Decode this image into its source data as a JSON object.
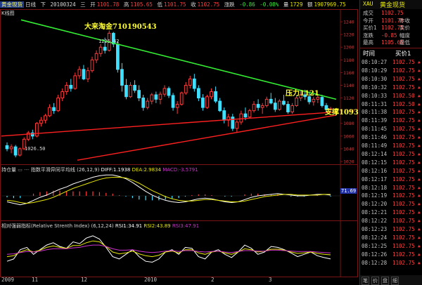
{
  "quote_bar": {
    "name": "黄金现货",
    "period": "日线",
    "direction": "下",
    "date": "20100324",
    "weekday": "三",
    "open_label": "开",
    "open": "1101.78",
    "high_label": "高",
    "high": "1105.65",
    "low_label": "低",
    "low": "1101.75",
    "close_label": "收",
    "close": "1102.75",
    "change_label": "涨跌",
    "change": "-0.86",
    "change_pct": "-0.08%",
    "volume_label": "量",
    "volume": "1729",
    "amount_label": "额",
    "amount": "1907969.75"
  },
  "main_panel": {
    "tag": "K线图",
    "price_axis": [
      "1240",
      "1220",
      "1200",
      "1180",
      "1160",
      "1140",
      "1120",
      "1100",
      "1080",
      "1060",
      "1040",
      "1020"
    ],
    "high_mark": "1226.42",
    "low_mark": "1026.50",
    "annotation_title": "大来淘金710190543",
    "annotation_resistance": "压力1121",
    "annotation_support": "支撑1093"
  },
  "macd_panel": {
    "title": "持仓量",
    "desc": "指数平滑异同平均线",
    "params": "(26,12,9)",
    "diff_label": "DIFF:",
    "diff": "1.1938",
    "dea_label": "DEA:",
    "dea": "2.9834",
    "macd_label": "MACD:",
    "macd": "-3.5791",
    "right_value": "71.69"
  },
  "rsi_panel": {
    "title": "相对强弱指标(Relative Strenth Index)",
    "params": "(6,12,24)",
    "rsi1_label": "RSI1:",
    "rsi1": "34.91",
    "rsi2_label": "RSI2:",
    "rsi2": "43.89",
    "rsi3_label": "RSI3:",
    "rsi3": "47.91"
  },
  "x_axis": {
    "labels": [
      "2009",
      "11",
      "12",
      "2010",
      "2",
      "3"
    ]
  },
  "right_panel": {
    "code": "XAU",
    "name": "黄金现货",
    "rows": [
      {
        "k": "成交",
        "v": "1102.75",
        "k2": ""
      },
      {
        "k": "今开",
        "v": "1101.78",
        "k2": "昨收"
      },
      {
        "k": "买价1",
        "v": "1102.75",
        "k2": "卖价"
      },
      {
        "k": "涨跌",
        "v": "-0.85",
        "k2": "幅度"
      },
      {
        "k": "最高",
        "v": "1105.65",
        "k2": "最低"
      }
    ],
    "trade_header_time": "时间",
    "trade_header_price": "买价1",
    "trades": [
      {
        "time": "08:10:27",
        "price": "1102.75"
      },
      {
        "time": "08:10:29",
        "price": "1102.75"
      },
      {
        "time": "08:10:30",
        "price": "1102.75"
      },
      {
        "time": "08:10:32",
        "price": "1102.75"
      },
      {
        "time": "08:10:33",
        "price": "1102.50"
      },
      {
        "time": "08:11:31",
        "price": "1102.50"
      },
      {
        "time": "08:11:38",
        "price": "1102.75"
      },
      {
        "time": "08:11:39",
        "price": "1102.75"
      },
      {
        "time": "08:11:45",
        "price": "1102.75"
      },
      {
        "time": "08:11:46",
        "price": "1102.75"
      },
      {
        "time": "08:11:49",
        "price": "1102.75"
      },
      {
        "time": "08:12:14",
        "price": "1102.75"
      },
      {
        "time": "08:12:15",
        "price": "1102.75"
      },
      {
        "time": "08:12:16",
        "price": "1102.75"
      },
      {
        "time": "08:12:17",
        "price": "1102.75"
      },
      {
        "time": "08:12:18",
        "price": "1102.75"
      },
      {
        "time": "08:12:19",
        "price": "1102.75"
      },
      {
        "time": "08:12:20",
        "price": "1102.75"
      },
      {
        "time": "08:12:21",
        "price": "1102.75"
      },
      {
        "time": "08:12:22",
        "price": "1102.75"
      },
      {
        "time": "08:12:23",
        "price": "1102.75"
      },
      {
        "time": "08:12:24",
        "price": "1102.75"
      },
      {
        "time": "08:12:25",
        "price": "1102.75"
      },
      {
        "time": "08:12:26",
        "price": "1102.75"
      },
      {
        "time": "08:12:28",
        "price": "1102.75"
      }
    ],
    "bottom_tabs": [
      "笔",
      "价",
      "盘",
      "细"
    ]
  },
  "colors": {
    "up": "#ff3b3b",
    "down": "#3fe0ff",
    "resistance_line": "#33ee33",
    "support_line": "#ff2020",
    "annotation": "#ffff33",
    "rsi1": "#ffffff",
    "rsi2": "#e8e800",
    "rsi3": "#cc33cc",
    "diff": "#ffffff",
    "dea": "#e8e800"
  },
  "chart_data": [
    {
      "type": "candlestick",
      "title": "",
      "y_range": [
        1020,
        1250
      ],
      "series": [
        {
          "name": "candles",
          "values": [
            [
              1045,
              1050,
              1036,
              1040
            ],
            [
              1040,
              1047,
              1033,
              1043
            ],
            [
              1043,
              1046,
              1026.5,
              1030
            ],
            [
              1030,
              1042,
              1028,
              1040
            ],
            [
              1040,
              1058,
              1038,
              1055
            ],
            [
              1055,
              1068,
              1052,
              1065
            ],
            [
              1065,
              1070,
              1055,
              1060
            ],
            [
              1060,
              1082,
              1058,
              1080
            ],
            [
              1080,
              1090,
              1075,
              1085
            ],
            [
              1085,
              1095,
              1080,
              1092
            ],
            [
              1092,
              1110,
              1090,
              1105
            ],
            [
              1105,
              1112,
              1095,
              1100
            ],
            [
              1100,
              1125,
              1098,
              1120
            ],
            [
              1120,
              1135,
              1115,
              1130
            ],
            [
              1130,
              1145,
              1125,
              1140
            ],
            [
              1140,
              1150,
              1130,
              1135
            ],
            [
              1135,
              1160,
              1133,
              1155
            ],
            [
              1155,
              1170,
              1150,
              1165
            ],
            [
              1165,
              1172,
              1148,
              1150
            ],
            [
              1150,
              1168,
              1145,
              1163
            ],
            [
              1163,
              1185,
              1160,
              1180
            ],
            [
              1180,
              1195,
              1175,
              1190
            ],
            [
              1190,
              1205,
              1185,
              1200
            ],
            [
              1200,
              1215,
              1190,
              1195
            ],
            [
              1195,
              1226.42,
              1193,
              1222
            ],
            [
              1222,
              1224,
              1200,
              1205
            ],
            [
              1205,
              1210,
              1160,
              1165
            ],
            [
              1165,
              1175,
              1130,
              1140
            ],
            [
              1140,
              1150,
              1118,
              1122
            ],
            [
              1122,
              1145,
              1120,
              1140
            ],
            [
              1140,
              1148,
              1128,
              1132
            ],
            [
              1132,
              1140,
              1115,
              1120
            ],
            [
              1120,
              1125,
              1100,
              1105
            ],
            [
              1105,
              1120,
              1102,
              1115
            ],
            [
              1115,
              1128,
              1110,
              1125
            ],
            [
              1125,
              1130,
              1112,
              1118
            ],
            [
              1118,
              1130,
              1110,
              1126
            ],
            [
              1126,
              1140,
              1122,
              1135
            ],
            [
              1135,
              1138,
              1120,
              1124
            ],
            [
              1124,
              1128,
              1100,
              1105
            ],
            [
              1105,
              1115,
              1095,
              1110
            ],
            [
              1110,
              1130,
              1108,
              1128
            ],
            [
              1128,
              1145,
              1125,
              1140
            ],
            [
              1140,
              1155,
              1135,
              1150
            ],
            [
              1150,
              1158,
              1130,
              1135
            ],
            [
              1135,
              1140,
              1115,
              1120
            ],
            [
              1120,
              1126,
              1100,
              1105
            ],
            [
              1105,
              1125,
              1103,
              1122
            ],
            [
              1122,
              1135,
              1118,
              1130
            ],
            [
              1130,
              1138,
              1112,
              1115
            ],
            [
              1115,
              1120,
              1098,
              1100
            ],
            [
              1100,
              1105,
              1080,
              1085
            ],
            [
              1085,
              1095,
              1075,
              1090
            ],
            [
              1090,
              1095,
              1068,
              1072
            ],
            [
              1072,
              1085,
              1065,
              1082
            ],
            [
              1082,
              1100,
              1078,
              1095
            ],
            [
              1095,
              1105,
              1085,
              1090
            ],
            [
              1090,
              1103,
              1088,
              1100
            ],
            [
              1100,
              1115,
              1097,
              1110
            ],
            [
              1110,
              1118,
              1100,
              1105
            ],
            [
              1105,
              1112,
              1095,
              1108
            ],
            [
              1108,
              1122,
              1105,
              1118
            ],
            [
              1118,
              1128,
              1110,
              1112
            ],
            [
              1112,
              1120,
              1098,
              1102
            ],
            [
              1102,
              1118,
              1100,
              1115
            ],
            [
              1115,
              1125,
              1108,
              1110
            ],
            [
              1110,
              1115,
              1095,
              1098
            ],
            [
              1098,
              1112,
              1095,
              1108
            ],
            [
              1108,
              1124,
              1106,
              1120
            ],
            [
              1120,
              1130,
              1115,
              1125
            ],
            [
              1125,
              1133,
              1117,
              1122
            ],
            [
              1122,
              1128,
              1110,
              1114
            ],
            [
              1114,
              1122,
              1108,
              1118
            ],
            [
              1118,
              1126,
              1112,
              1121
            ],
            [
              1121,
              1125,
              1105,
              1108
            ],
            [
              1108,
              1112,
              1098,
              1102
            ],
            [
              1102,
              1106,
              1100,
              1103
            ]
          ]
        }
      ]
    },
    {
      "type": "line",
      "title": "指数平滑异同平均线",
      "series": [
        {
          "name": "DIFF",
          "values": [
            -8,
            -10,
            -12,
            -10,
            -6,
            -2,
            1,
            5,
            9,
            12,
            16,
            19,
            22,
            25,
            27,
            28,
            28,
            26,
            23,
            18,
            12,
            6,
            1,
            -3,
            -6,
            -8,
            -9,
            -8,
            -6,
            -4,
            -3,
            -4,
            -6,
            -8,
            -9,
            -8,
            -5,
            -2,
            0,
            1,
            2,
            3,
            2,
            1,
            0,
            0,
            1,
            2,
            2,
            1
          ]
        },
        {
          "name": "DEA",
          "values": [
            -6,
            -7,
            -9,
            -10,
            -9,
            -7,
            -5,
            -2,
            2,
            6,
            10,
            13,
            16,
            19,
            22,
            24,
            25,
            25,
            24,
            21,
            17,
            12,
            7,
            3,
            -1,
            -4,
            -6,
            -7,
            -7,
            -6,
            -5,
            -5,
            -6,
            -7,
            -8,
            -8,
            -7,
            -5,
            -3,
            -1,
            0,
            1,
            2,
            2,
            1,
            1,
            1,
            1,
            2,
            2
          ]
        },
        {
          "name": "MACD",
          "values": [
            -2,
            -3,
            -3,
            0,
            3,
            5,
            6,
            7,
            7,
            6,
            6,
            6,
            6,
            6,
            5,
            4,
            3,
            1,
            -1,
            -3,
            -5,
            -6,
            -6,
            -6,
            -5,
            -4,
            -3,
            -1,
            1,
            2,
            2,
            1,
            0,
            -1,
            -1,
            0,
            2,
            3,
            3,
            2,
            2,
            2,
            0,
            -1,
            -1,
            -1,
            0,
            1,
            0,
            -1
          ]
        }
      ]
    },
    {
      "type": "line",
      "title": "相对强弱指标",
      "y_range": [
        0,
        100
      ],
      "series": [
        {
          "name": "RSI1",
          "values": [
            30,
            35,
            55,
            60,
            45,
            55,
            65,
            70,
            62,
            58,
            72,
            68,
            80,
            85,
            78,
            60,
            40,
            35,
            45,
            55,
            40,
            30,
            28,
            35,
            50,
            55,
            45,
            60,
            58,
            40,
            35,
            50,
            55,
            45,
            38,
            50,
            65,
            58,
            45,
            50,
            62,
            60,
            55,
            48,
            40,
            45,
            50,
            42,
            38,
            35
          ]
        },
        {
          "name": "RSI2",
          "values": [
            40,
            42,
            50,
            55,
            50,
            54,
            60,
            63,
            60,
            58,
            64,
            64,
            70,
            74,
            72,
            62,
            50,
            46,
            48,
            52,
            46,
            42,
            40,
            43,
            50,
            52,
            48,
            55,
            55,
            48,
            45,
            50,
            52,
            48,
            45,
            50,
            57,
            55,
            50,
            52,
            56,
            56,
            54,
            50,
            47,
            48,
            50,
            47,
            45,
            44
          ]
        },
        {
          "name": "RSI3",
          "values": [
            45,
            46,
            49,
            51,
            50,
            52,
            55,
            57,
            57,
            57,
            59,
            60,
            63,
            65,
            65,
            62,
            57,
            54,
            54,
            55,
            52,
            50,
            49,
            50,
            52,
            53,
            51,
            53,
            53,
            51,
            50,
            51,
            52,
            50,
            49,
            51,
            53,
            53,
            52,
            52,
            54,
            54,
            53,
            52,
            51,
            51,
            51,
            50,
            49,
            48
          ]
        }
      ]
    }
  ]
}
